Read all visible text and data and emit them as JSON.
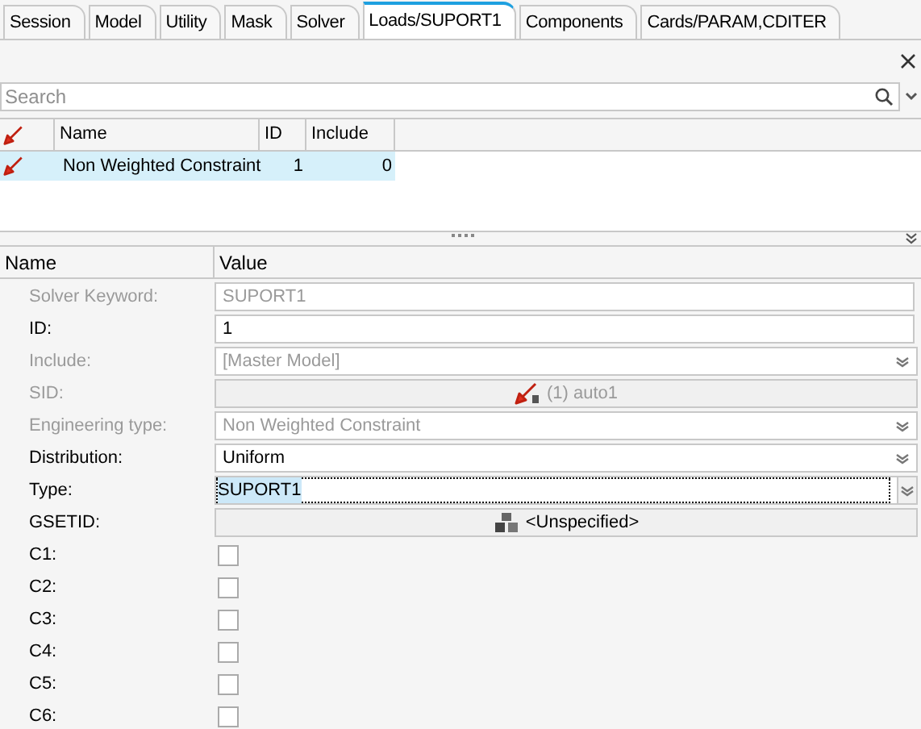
{
  "tabs": [
    {
      "label": "Session",
      "selected": false
    },
    {
      "label": "Model",
      "selected": false
    },
    {
      "label": "Utility",
      "selected": false
    },
    {
      "label": "Mask",
      "selected": false
    },
    {
      "label": "Solver",
      "selected": false
    },
    {
      "label": "Loads/SUPORT1",
      "selected": true
    },
    {
      "label": "Components",
      "selected": false
    },
    {
      "label": "Cards/PARAM,CDITER",
      "selected": false
    }
  ],
  "search": {
    "placeholder": "Search"
  },
  "table": {
    "columns": [
      "Name",
      "ID",
      "Include"
    ],
    "rows": [
      {
        "cells": [
          "Non Weighted Constraint",
          "1",
          "0"
        ],
        "selected": true
      }
    ]
  },
  "properties": {
    "columns": [
      "Name",
      "Value"
    ],
    "rows": [
      {
        "label": "Solver Keyword:",
        "kind": "text",
        "value": "SUPORT1",
        "disabled": true
      },
      {
        "label": "ID:",
        "kind": "text",
        "value": "1",
        "disabled": false
      },
      {
        "label": "Include:",
        "kind": "select",
        "value": "[Master Model]",
        "disabled": true
      },
      {
        "label": "SID:",
        "kind": "entity",
        "value": "(1) auto1",
        "disabled": true
      },
      {
        "label": "Engineering type:",
        "kind": "select",
        "value": "Non Weighted Constraint",
        "disabled": true
      },
      {
        "label": "Distribution:",
        "kind": "select",
        "value": "Uniform",
        "disabled": false
      },
      {
        "label": "Type:",
        "kind": "select",
        "value": "SUPORT1",
        "disabled": false,
        "focused": true
      },
      {
        "label": "GSETID:",
        "kind": "set",
        "value": "<Unspecified>",
        "disabled": false
      },
      {
        "label": "C1:",
        "kind": "checkbox",
        "checked": false
      },
      {
        "label": "C2:",
        "kind": "checkbox",
        "checked": false
      },
      {
        "label": "C3:",
        "kind": "checkbox",
        "checked": false
      },
      {
        "label": "C4:",
        "kind": "checkbox",
        "checked": false
      },
      {
        "label": "C5:",
        "kind": "checkbox",
        "checked": false
      },
      {
        "label": "C6:",
        "kind": "checkbox",
        "checked": false
      }
    ]
  }
}
